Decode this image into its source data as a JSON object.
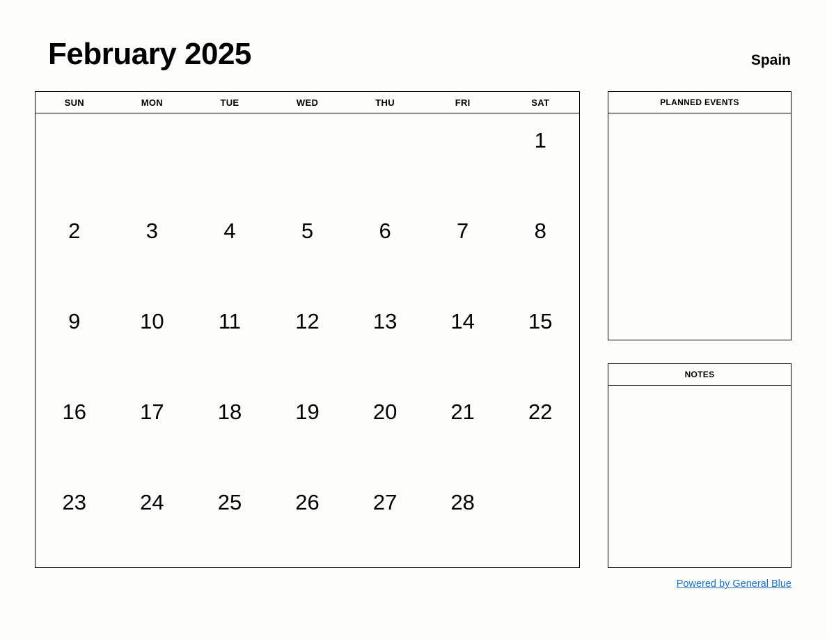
{
  "header": {
    "month_title": "February 2025",
    "region": "Spain"
  },
  "calendar": {
    "weekday_headers": [
      "SUN",
      "MON",
      "TUE",
      "WED",
      "THU",
      "FRI",
      "SAT"
    ],
    "weeks": [
      [
        "",
        "",
        "",
        "",
        "",
        "",
        "1"
      ],
      [
        "2",
        "3",
        "4",
        "5",
        "6",
        "7",
        "8"
      ],
      [
        "9",
        "10",
        "11",
        "12",
        "13",
        "14",
        "15"
      ],
      [
        "16",
        "17",
        "18",
        "19",
        "20",
        "21",
        "22"
      ],
      [
        "23",
        "24",
        "25",
        "26",
        "27",
        "28",
        ""
      ]
    ]
  },
  "panels": {
    "planned_events": {
      "title": "PLANNED EVENTS",
      "content": ""
    },
    "notes": {
      "title": "NOTES",
      "content": ""
    }
  },
  "footer": {
    "link_text": "Powered by General Blue"
  },
  "colors": {
    "page_background": "#fdfdfc",
    "text": "#000000",
    "border": "#000000",
    "link": "#1d6fc0"
  }
}
